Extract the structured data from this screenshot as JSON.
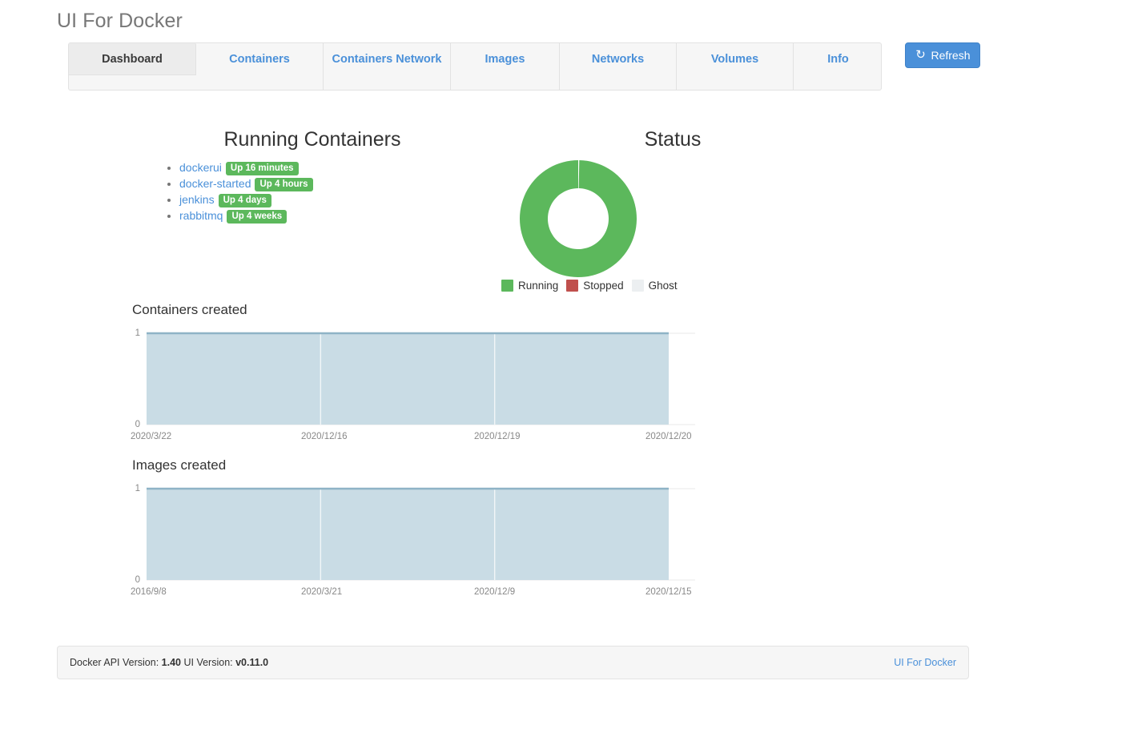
{
  "app": {
    "title": "UI For Docker"
  },
  "tabs": [
    {
      "label": "Dashboard",
      "active": true
    },
    {
      "label": "Containers",
      "active": false
    },
    {
      "label": "Containers Network",
      "active": false
    },
    {
      "label": "Images",
      "active": false
    },
    {
      "label": "Networks",
      "active": false
    },
    {
      "label": "Volumes",
      "active": false
    },
    {
      "label": "Info",
      "active": false
    }
  ],
  "toolbar": {
    "refresh_label": "Refresh",
    "refresh_icon": "refresh-icon",
    "refresh_glyph": "↻",
    "accent_color": "#4a90d9"
  },
  "running_containers": {
    "title": "Running Containers",
    "items": [
      {
        "name": "dockerui",
        "status": "Up 16 minutes"
      },
      {
        "name": "docker-started",
        "status": "Up 4 hours"
      },
      {
        "name": "jenkins",
        "status": "Up 4 days"
      },
      {
        "name": "rabbitmq",
        "status": "Up 4 weeks"
      }
    ],
    "badge_color": "#5cb85c",
    "link_color": "#4a90d9"
  },
  "status_panel": {
    "title": "Status"
  },
  "charts": {
    "containers_created_title": "Containers created",
    "images_created_title": "Images created"
  },
  "footer": {
    "api_version_label": "Docker API Version:",
    "api_version_value": "1.40",
    "ui_version_label": "UI Version:",
    "ui_version_value": "v0.11.0",
    "link_label": "UI For Docker"
  },
  "chart_data": [
    {
      "type": "pie",
      "title": "Status",
      "variant": "donut",
      "legend_position": "bottom",
      "labels": [
        "Running",
        "Stopped",
        "Ghost"
      ],
      "values": [
        4,
        0,
        0
      ],
      "percentages": [
        100,
        0,
        0
      ],
      "colors": [
        "#5cb85c",
        "#c0504d",
        "#eceff1"
      ]
    },
    {
      "type": "area",
      "title": "Containers created",
      "xlabel": "",
      "ylabel": "",
      "ylim": [
        0,
        1
      ],
      "ytick_labels": [
        "0",
        "1"
      ],
      "x": [
        "2020/3/22",
        "2020/12/16",
        "2020/12/19",
        "2020/12/20"
      ],
      "xtick_labels": [
        "2020/3/22",
        "2020/12/16",
        "2020/12/19",
        "2020/12/20"
      ],
      "values": [
        1,
        1,
        1,
        1
      ],
      "grid": true,
      "fill_color": "#c9dce5",
      "line_color": "#8fb3c6"
    },
    {
      "type": "area",
      "title": "Images created",
      "xlabel": "",
      "ylabel": "",
      "ylim": [
        0,
        1
      ],
      "ytick_labels": [
        "0",
        "1"
      ],
      "x": [
        "2016/9/8",
        "2020/3/21",
        "2020/12/9",
        "2020/12/15"
      ],
      "xtick_labels": [
        "2016/9/8",
        "2020/3/21",
        "2020/12/9",
        "2020/12/15"
      ],
      "values": [
        1,
        1,
        1,
        1
      ],
      "grid": true,
      "fill_color": "#c9dce5",
      "line_color": "#8fb3c6"
    }
  ]
}
